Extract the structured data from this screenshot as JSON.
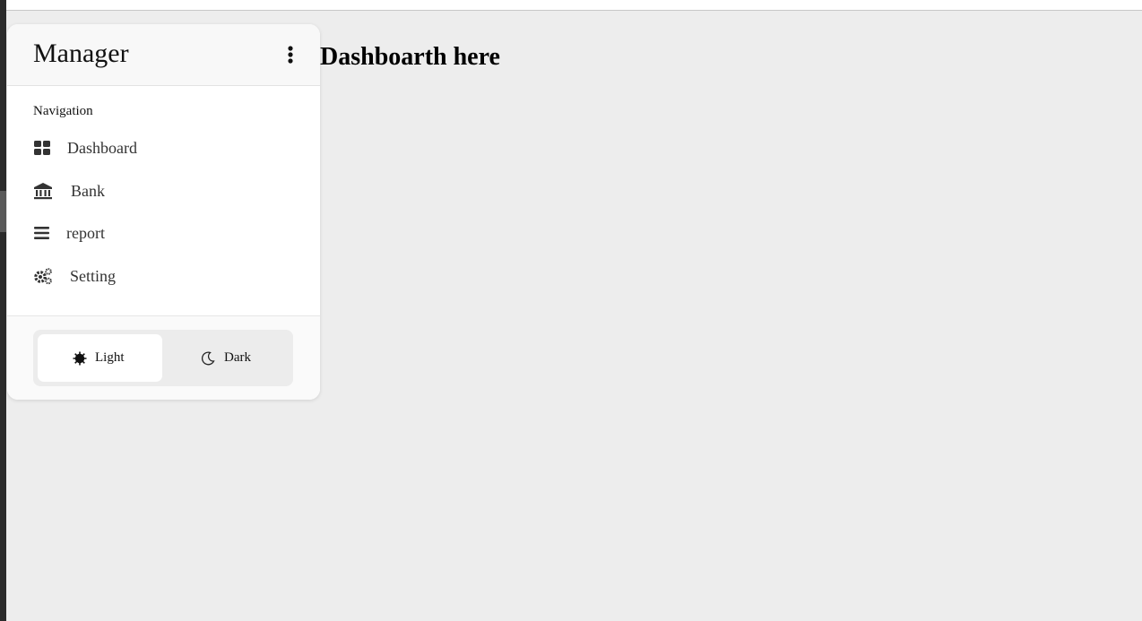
{
  "sidebar": {
    "title": "Manager",
    "section_label": "Navigation",
    "items": [
      {
        "label": "Dashboard",
        "icon": "grid-icon"
      },
      {
        "label": "Bank",
        "icon": "bank-icon"
      },
      {
        "label": "report",
        "icon": "list-icon"
      },
      {
        "label": "Setting",
        "icon": "gears-icon"
      }
    ],
    "theme": {
      "light_label": "Light",
      "dark_label": "Dark",
      "selected": "Light"
    }
  },
  "main": {
    "heading": "Dashboarth here"
  }
}
